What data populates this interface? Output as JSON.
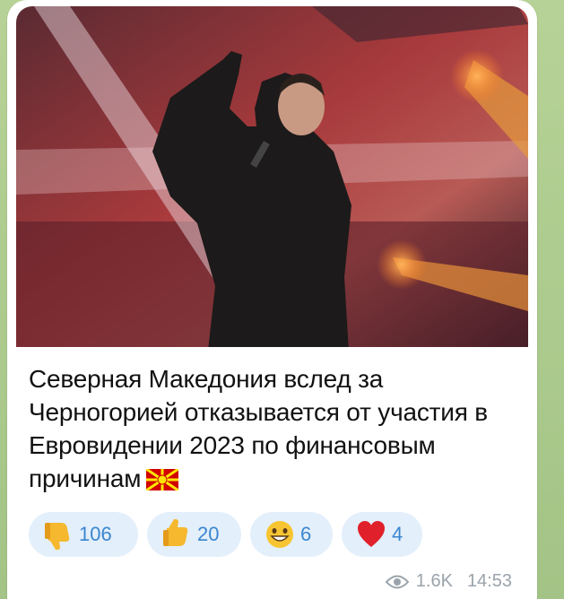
{
  "message": {
    "text": "Северная Македония вслед за Черногорией отказывается от участия в Евровидении 2023 по финансовым причинам",
    "flag_icon": "north-macedonia-flag"
  },
  "reactions": [
    {
      "emoji": "thumbs-down",
      "count": "106"
    },
    {
      "emoji": "thumbs-up",
      "count": "20"
    },
    {
      "emoji": "grinning-face",
      "count": "6"
    },
    {
      "emoji": "red-heart",
      "count": "4"
    }
  ],
  "meta": {
    "views": "1.6K",
    "time": "14:53"
  },
  "colors": {
    "reaction_bg": "#e3effb",
    "reaction_text": "#3a86d0",
    "meta_text": "#9aa3ab"
  }
}
